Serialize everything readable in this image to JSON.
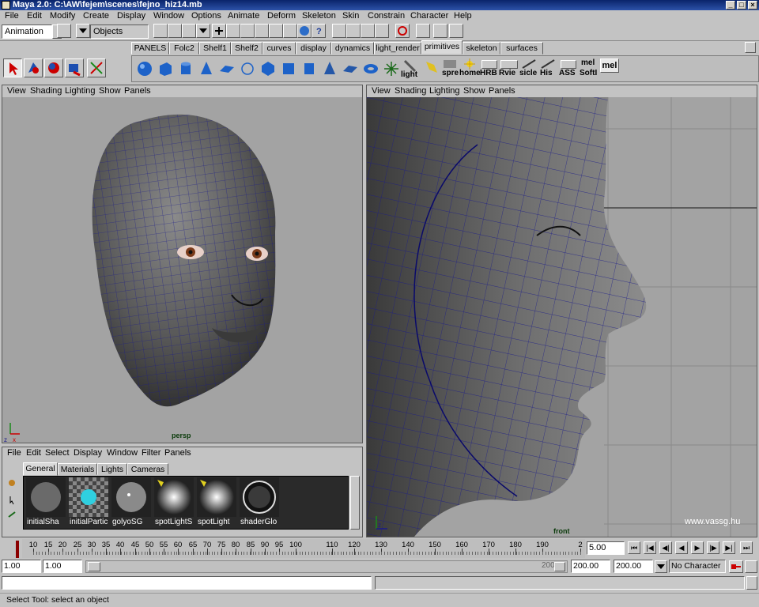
{
  "window": {
    "title": "Maya 2.0: C:\\AW\\fejem\\scenes\\fejno_hiz14.mb"
  },
  "menubar": [
    "File",
    "Edit",
    "Modify",
    "Create",
    "Display",
    "Window",
    "Options",
    "Animate",
    "Deform",
    "Skeleton",
    "Skin",
    "Constrain",
    "Character",
    "Help"
  ],
  "status": {
    "mode": "Animation",
    "selection_mask": "Objects"
  },
  "shelf_tabs": [
    "PANELS",
    "Folc2",
    "Shelf1",
    "Shelf2",
    "curves",
    "display",
    "dynamics",
    "light_render",
    "primitives",
    "skeleton",
    "surfaces"
  ],
  "shelf_active": "primitives",
  "shelf_labels": [
    "light",
    "spre",
    "home",
    "HRB",
    "Rvie",
    "sicle",
    "His",
    "ASS",
    "SoftI",
    "mel",
    "mel"
  ],
  "persp_panel": {
    "menu": [
      "View",
      "Shading",
      "Lighting",
      "Show",
      "Panels"
    ],
    "camera": "persp"
  },
  "front_panel": {
    "menu": [
      "View",
      "Shading",
      "Lighting",
      "Show",
      "Panels"
    ],
    "camera": "front",
    "watermark": "www.vassg.hu"
  },
  "hypershade": {
    "menu": [
      "File",
      "Edit",
      "Select",
      "Display",
      "Window",
      "Filter",
      "Panels"
    ],
    "tabs": [
      "General",
      "Materials",
      "Lights",
      "Cameras"
    ],
    "active_tab": "General",
    "swatches": [
      "initialSha",
      "initialPartic",
      "golyoSG",
      "spotLightS",
      "spotLight",
      "shaderGlo"
    ]
  },
  "timeline": {
    "ticks": [
      "10",
      "15",
      "20",
      "25",
      "30",
      "35",
      "40",
      "45",
      "50",
      "55",
      "60",
      "65",
      "70",
      "75",
      "80",
      "85",
      "90",
      "95",
      "100",
      "110",
      "120",
      "130",
      "140",
      "150",
      "160",
      "170",
      "180",
      "190",
      "2"
    ],
    "current_time": "5.00"
  },
  "range": {
    "start_time": "1.00",
    "playback_start": "1.00",
    "slider_end_label": "200",
    "playback_end": "200.00",
    "end_time": "200.00",
    "character": "No Character"
  },
  "help_line": "Select Tool: select an object",
  "colors": {
    "title_bar": "#0a246a",
    "viewport": "#a3a3a3",
    "wire": "#1a1a8a",
    "timeline_marker": "#8a0000"
  }
}
